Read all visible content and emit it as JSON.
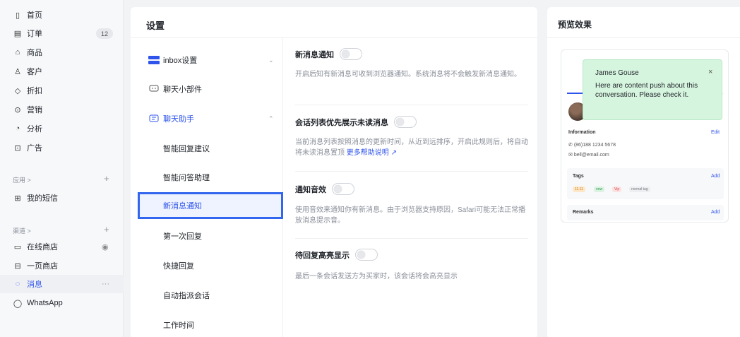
{
  "nav": {
    "items": [
      {
        "label": "首页",
        "icon": "▯"
      },
      {
        "label": "订单",
        "icon": "▤",
        "badge": "12"
      },
      {
        "label": "商品",
        "icon": "⌂"
      },
      {
        "label": "客户",
        "icon": "♙"
      },
      {
        "label": "折扣",
        "icon": "◇"
      },
      {
        "label": "营销",
        "icon": "⊙"
      },
      {
        "label": "分析",
        "icon": "◔"
      },
      {
        "label": "广告",
        "icon": "⊡"
      }
    ],
    "apps_section": "应用 >",
    "apps_items": [
      {
        "label": "我的短信",
        "icon": "⊞"
      }
    ],
    "channels_section": "渠道 >",
    "channel_items": [
      {
        "label": "在线商店",
        "icon": "▭",
        "extra": "◉"
      },
      {
        "label": "一页商店",
        "icon": "⊟"
      },
      {
        "label": "消息",
        "icon": "◌",
        "extra": "···"
      },
      {
        "label": "WhatsApp",
        "icon": "◯"
      }
    ],
    "plus": "+"
  },
  "settings": {
    "title": "设置",
    "groups": [
      {
        "label": "inbox设置",
        "chevron": "⌄"
      },
      {
        "label": "聊天小部件"
      },
      {
        "label": "聊天助手",
        "chevron": "⌃"
      }
    ],
    "children": [
      "智能回复建议",
      "智能问答助理",
      "新消息通知",
      "第一次回复",
      "快捷回复",
      "自动指派会话",
      "工作时间"
    ],
    "options": [
      {
        "title": "新消息通知",
        "desc": "开启后知有新消息可收到浏览器通知。系统消息将不会触发新消息通知。",
        "on": false
      },
      {
        "title": "会话列表优先展示未读消息",
        "desc": "当前消息列表按照消息的更新时间，从近到远排序，开启此规则后，将自动将未读消息置顶",
        "link": "更多帮助说明",
        "on": false
      },
      {
        "title": "通知音效",
        "desc": "使用音效来通知你有新消息。由于浏览器支持原因，Safari可能无法正常播放消息提示音。",
        "on": false
      },
      {
        "title": "待回复高亮显示",
        "desc": "最后一条会话发送方为买家时，该会话将会高亮显示",
        "on": false
      }
    ]
  },
  "preview": {
    "title": "预览效果",
    "popup": {
      "name": "James Gouse",
      "message": "Here are content push about this conversation. Please check it.",
      "close": "×"
    },
    "info_label": "Information",
    "edit": "Edit",
    "phone": "(86)188 1234 5678",
    "email": "bell@email.com",
    "tags_label": "Tags",
    "add": "Add",
    "tags": [
      "11.11",
      "new",
      "Vip",
      "normal tag"
    ],
    "remarks_label": "Remarks"
  },
  "colors": {
    "accent": "#2f54eb",
    "popup_bg": "#d6f5df",
    "selected_border": "#3366ee"
  }
}
